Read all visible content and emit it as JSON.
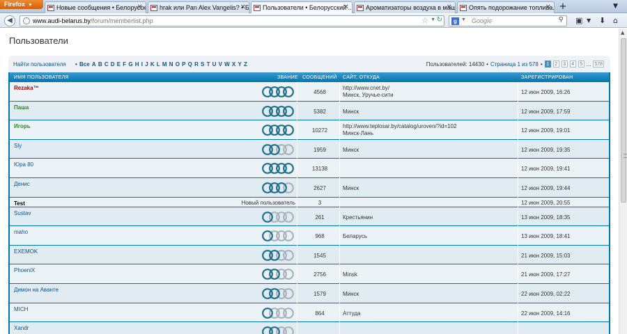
{
  "browser": {
    "menu_label": "Firefox",
    "tabs": [
      {
        "title": "Новые сообщения • Белорусск..."
      },
      {
        "title": "hrak или Pan Alex Vangelis? • Б..."
      },
      {
        "title": "Пользователи • Белорусский ...",
        "active": true
      },
      {
        "title": "Ароматизаторы воздуха в маш..."
      },
      {
        "title": "Опять подорожание топлива...."
      }
    ],
    "url_host": "www.audi-belarus.by",
    "url_path": "/forum/memberlist.php",
    "search_placeholder": "Google"
  },
  "page": {
    "title": "Пользователи",
    "find_label": "Найти пользователя",
    "all_label": "• Все",
    "letters": [
      "A",
      "B",
      "C",
      "D",
      "E",
      "F",
      "G",
      "H",
      "I",
      "J",
      "K",
      "L",
      "M",
      "N",
      "O",
      "P",
      "Q",
      "R",
      "S",
      "T",
      "U",
      "V",
      "W",
      "X",
      "Y",
      "Z"
    ],
    "users_count": "Пользователей: 14430",
    "page_label": "Страница 1 из 578",
    "pages": [
      "1",
      "2",
      "3",
      "4",
      "5"
    ],
    "ellipsis": "...",
    "last_page": "578"
  },
  "table": {
    "headers": {
      "name": "ИМЯ ПОЛЬЗОВАТЕЛЯ",
      "rank": "ЗВАНИЕ",
      "posts": "СООБЩЕНИЙ",
      "site": "САЙТ, ОТКУДА",
      "registered": "ЗАРЕГИСТРИРОВАН"
    },
    "rows": [
      {
        "name": "Rezaka™",
        "color": "red",
        "rings": 4,
        "posts": "4568",
        "site": "http://www.cnet.by/",
        "location": "Минск, Уручье-сити",
        "registered": "12 июн 2009, 16:26"
      },
      {
        "name": "Паша",
        "color": "green",
        "rings": 4,
        "posts": "5382",
        "site": "",
        "location": "Минск",
        "registered": "12 июн 2009, 17:59"
      },
      {
        "name": "Игорь",
        "color": "green",
        "rings": 4,
        "posts": "10272",
        "site": "http://www.teplosar.by/catalog/uroven/?id=102",
        "location": "Минск-Лань",
        "registered": "12 июн 2009, 19:01"
      },
      {
        "name": "Sly",
        "color": "normal",
        "rings": 2,
        "posts": "1959",
        "site": "",
        "location": "Минск",
        "registered": "12 июн 2009, 19:35"
      },
      {
        "name": "Юра 80",
        "color": "normal",
        "rings": 4,
        "posts": "13138",
        "site": "",
        "location": "",
        "registered": "12 июн 2009, 19:41"
      },
      {
        "name": "Денис",
        "color": "normal",
        "rings": 3,
        "posts": "2627",
        "site": "",
        "location": "Минск",
        "registered": "12 июн 2009, 19:44"
      },
      {
        "name": "Test",
        "color": "black",
        "rank_text": "Новый пользователь",
        "posts": "3",
        "site": "",
        "location": "",
        "registered": "12 июн 2009, 20:55"
      },
      {
        "name": "Sustav",
        "color": "normal",
        "rings": 1,
        "posts": "261",
        "site": "",
        "location": "Крестьянин",
        "registered": "13 июн 2009, 18:35"
      },
      {
        "name": "maho",
        "color": "normal",
        "rings": 1,
        "posts": "968",
        "site": "",
        "location": "Беларусь",
        "registered": "13 июн 2009, 18:41"
      },
      {
        "name": "EXEMOK",
        "color": "normal",
        "rings": 2,
        "posts": "1545",
        "site": "",
        "location": "",
        "registered": "21 июн 2009, 15:03"
      },
      {
        "name": "PhoeniX",
        "color": "normal",
        "rings": 2,
        "posts": "2756",
        "site": "",
        "location": "Minsk",
        "registered": "21 июн 2009, 17:27"
      },
      {
        "name": "Димон на Аванте",
        "color": "normal",
        "rings": 2,
        "posts": "1579",
        "site": "",
        "location": "Минск",
        "registered": "22 июн 2009, 02:22"
      },
      {
        "name": "MICH",
        "color": "normal",
        "rings": 1,
        "posts": "864",
        "site": "",
        "location": "Аттуда",
        "registered": "22 июн 2009, 14:16"
      },
      {
        "name": "Xandr",
        "color": "normal",
        "rings": 2,
        "posts": "",
        "site": "",
        "location": "",
        "registered": ""
      }
    ]
  },
  "colors": {
    "ring_active": "#1f6e8c",
    "ring_inactive": "#a9b3bb"
  }
}
